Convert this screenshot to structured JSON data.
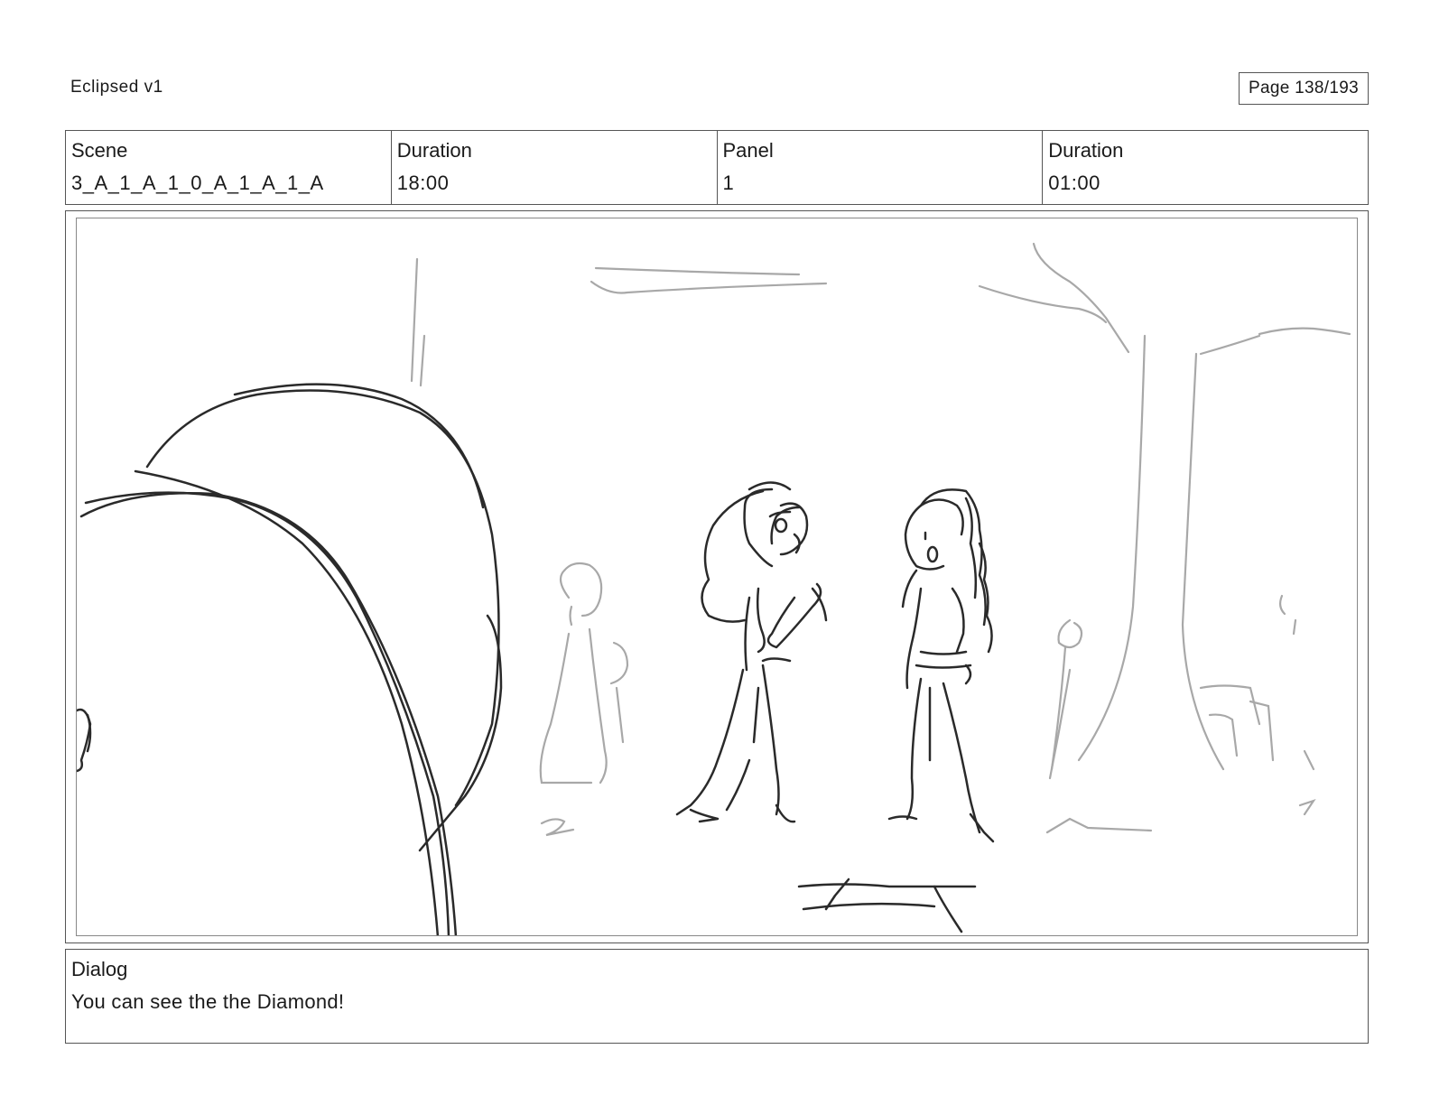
{
  "header": {
    "project_title": "Eclipsed v1",
    "page_label": "Page 138/193"
  },
  "info": {
    "scene_label": "Scene",
    "scene_value": "3_A_1_A_1_0_A_1_A_1_A",
    "scene_duration_label": "Duration",
    "scene_duration_value": "18:00",
    "panel_label": "Panel",
    "panel_value": "1",
    "panel_duration_label": "Duration",
    "panel_duration_value": "01:00"
  },
  "panel": {
    "colors": {
      "ink": "#2a2a2a",
      "sketch_gray": "#a8a8a8"
    }
  },
  "dialog": {
    "label": "Dialog",
    "text": "You can see the the Diamond!"
  }
}
